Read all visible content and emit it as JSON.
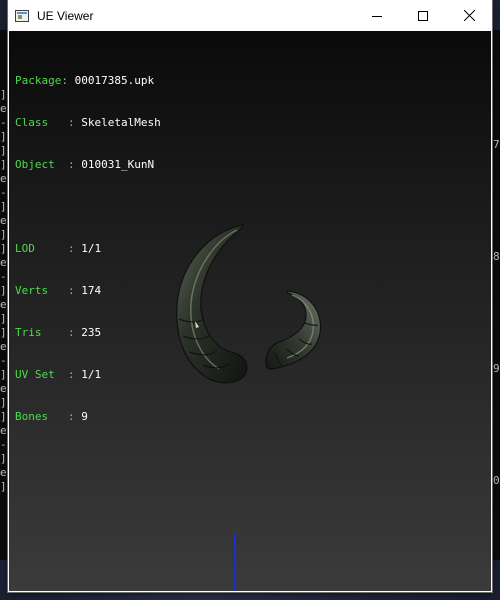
{
  "window": {
    "title": "UE Viewer"
  },
  "info": {
    "package_label": "Package: ",
    "package_value": "00017385.upk",
    "class_label": "Class   : ",
    "class_value": "SkeletalMesh",
    "object_label": "Object  : ",
    "object_value": "010031_KunN",
    "lod_label": "LOD     : ",
    "lod_value": "1/1",
    "verts_label": "Verts   : ",
    "verts_value": "174",
    "tris_label": "Tris    : ",
    "tris_value": "235",
    "uvset_label": "UV Set  : ",
    "uvset_value": "1/1",
    "bones_label": "Bones   : ",
    "bones_value": "9"
  },
  "background_console": {
    "left_fragments": [
      "]",
      "e",
      "-",
      "]",
      "]",
      "]",
      "e",
      "-",
      "]",
      "e",
      "]",
      "]",
      "e",
      "-",
      "]",
      "e",
      "]",
      "]",
      "e",
      "-",
      "]",
      "e",
      "]",
      "]",
      "e",
      "-",
      "]",
      "e",
      "]"
    ],
    "right_fragments": [
      "7",
      "8",
      "9",
      "0"
    ]
  },
  "colors": {
    "label_green": "#4ddc4d",
    "value_white": "#ffffff",
    "axis_blue": "#1a2fd0"
  }
}
